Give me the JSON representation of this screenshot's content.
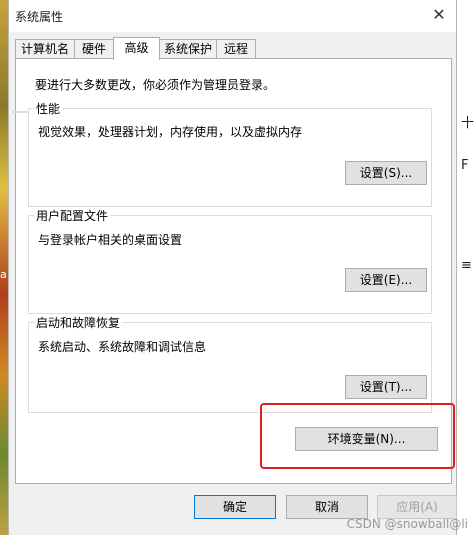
{
  "window": {
    "title": "系统属性",
    "close_glyph": "✕"
  },
  "tabs": [
    {
      "label": "计算机名"
    },
    {
      "label": "硬件"
    },
    {
      "label": "高级",
      "active": true
    },
    {
      "label": "系统保护"
    },
    {
      "label": "远程"
    }
  ],
  "admin_note": "要进行大多数更改，你必须作为管理员登录。",
  "performance": {
    "title": "性能",
    "description": "视觉效果，处理器计划，内存使用，以及虚拟内存",
    "button": "设置(S)..."
  },
  "user_profiles": {
    "title": "用户配置文件",
    "description": "与登录帐户相关的桌面设置",
    "button": "设置(E)..."
  },
  "startup_recovery": {
    "title": "启动和故障恢复",
    "description": "系统启动、系统故障和调试信息",
    "button": "设置(T)..."
  },
  "env_button": "环境变量(N)...",
  "footer": {
    "ok": "确定",
    "cancel": "取消",
    "apply": "应用(A)"
  },
  "right_glyphs": [
    "十",
    "F",
    "≡"
  ],
  "left_glyph": "a",
  "watermark": "CSDN @snowball@li"
}
